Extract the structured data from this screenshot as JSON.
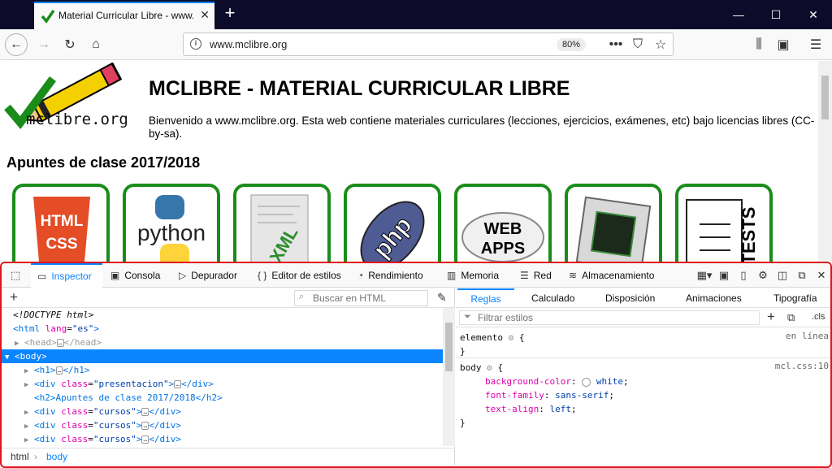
{
  "browser": {
    "tab_title": "Material Curricular Libre - www.mclibre.org",
    "url": "www.mclibre.org",
    "zoom": "80%"
  },
  "page": {
    "logo_text": "mclibre.org",
    "title": "MCLIBRE - MATERIAL CURRICULAR LIBRE",
    "intro": "Bienvenido a www.mclibre.org. Esta web contiene materiales curriculares (lecciones, ejercicios, exámenes, etc) bajo licencias libres (CC-by-sa).",
    "section_title": "Apuntes de clase 2017/2018",
    "courses": [
      "HTML CSS",
      "python",
      "XML",
      "php",
      "WEB APPS",
      "hardware",
      "TESTS"
    ],
    "course_labels": {
      "html_top": "HTML",
      "html_bottom": "CSS",
      "python": "python",
      "xml": "XML",
      "php": "php",
      "web_top": "WEB",
      "web_bottom": "APPS",
      "tests": "TESTS"
    }
  },
  "devtools": {
    "tabs": [
      "Inspector",
      "Consola",
      "Depurador",
      "Editor de estilos",
      "Rendimiento",
      "Memoria",
      "Red",
      "Almacenamiento"
    ],
    "search_placeholder": "Buscar en HTML",
    "markup": [
      {
        "pre": "",
        "text": "<!DOCTYPE html>"
      },
      {
        "tag": "html",
        "attr": "lang",
        "val": "es"
      }
    ],
    "markup_lines": {
      "doctype": "<!DOCTYPE html>",
      "html_open_tag": "<html ",
      "html_attr": "lang",
      "html_val": "\"es\"",
      "head": "<head>",
      "head_close": "</head>",
      "body": "<body>",
      "h1": "<h1>",
      "h1_close": "</h1>",
      "div": "<div ",
      "class": "class",
      "presentacion": "\"presentacion\"",
      "div_close": "</div>",
      "h2_text": "<h2>Apuntes de clase 2017/2018</h2>",
      "cursos": "\"cursos\""
    },
    "breadcrumb": [
      "html",
      "body"
    ],
    "side_tabs": [
      "Reglas",
      "Calculado",
      "Disposición",
      "Animaciones",
      "Tipografía"
    ],
    "filter_placeholder": "Filtrar estilos",
    "cls_label": ".cls",
    "rules": {
      "element_selector": "elemento",
      "element_source": "en línea",
      "body_selector": "body",
      "body_source": "mcl.css:10",
      "declarations": [
        {
          "prop": "background-color",
          "value": "white"
        },
        {
          "prop": "font-family",
          "value": "sans-serif"
        },
        {
          "prop": "text-align",
          "value": "left"
        }
      ]
    },
    "colors": {
      "accent": "#0a84ff",
      "highlight_border": "#e0141e",
      "course_border": "#1a8c1a"
    }
  }
}
